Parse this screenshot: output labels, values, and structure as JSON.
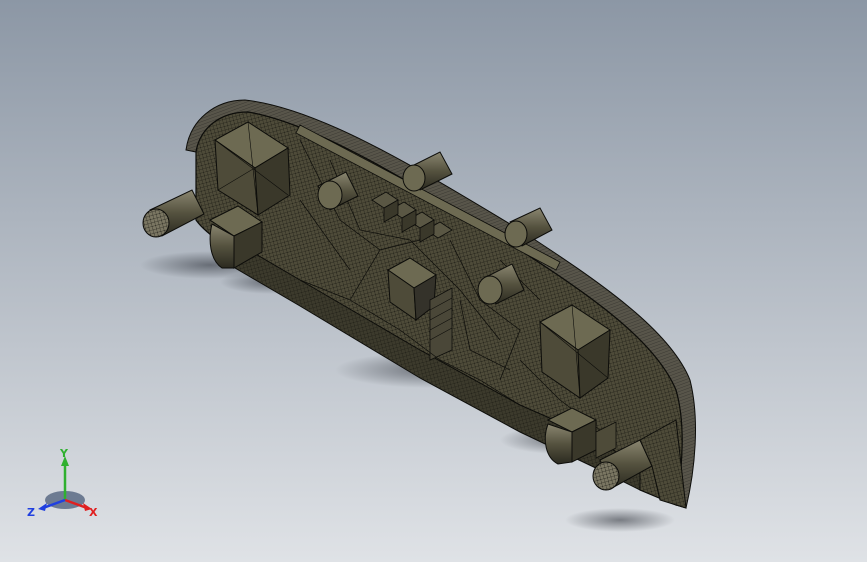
{
  "viewport": {
    "background_top": "#8c97a5",
    "background_bottom": "#dfe2e6"
  },
  "model": {
    "body_color": "#4e4b39",
    "body_light": "#6d6a52",
    "body_dark": "#2a2920",
    "edge_color": "#0d0d0a",
    "rim_color": "#58554a",
    "cylinder_color": "#5d5a48"
  },
  "triad": {
    "y_label": "Y",
    "x_label": "X",
    "z_label": "Z",
    "y_color": "#2fb02f",
    "x_color": "#e02020",
    "z_color": "#2040e0"
  }
}
